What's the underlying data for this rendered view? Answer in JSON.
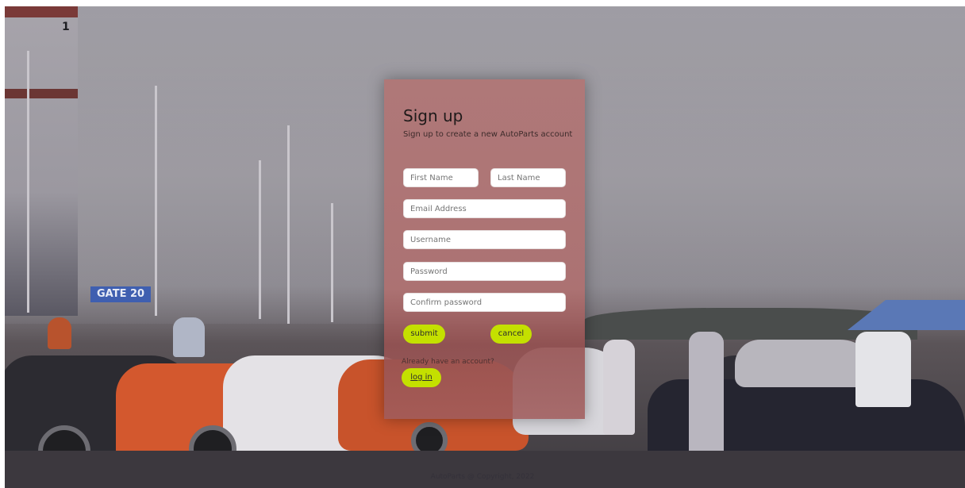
{
  "background": {
    "tower_number": "1",
    "gate_sign": "GATE 20"
  },
  "signup": {
    "title": "Sign up",
    "subtitle": "Sign up to create a new AutoParts account",
    "first_name_placeholder": "First Name",
    "last_name_placeholder": "Last Name",
    "email_placeholder": "Email Address",
    "username_placeholder": "Username",
    "password_placeholder": "Password",
    "confirm_password_placeholder": "Confirm password",
    "submit_label": "submit",
    "cancel_label": "cancel",
    "already_text": "Already have an account?",
    "login_label": "log in"
  },
  "footer": {
    "text": "AutoParts @ Copyright, 2022"
  },
  "colors": {
    "accent_button": "#c4e000",
    "card_background": "#b07676"
  }
}
